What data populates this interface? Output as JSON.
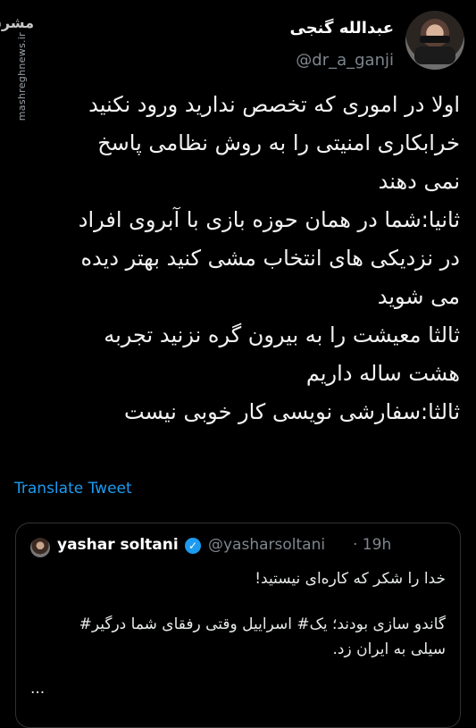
{
  "header": {
    "display_name": "عبدالله گنجی",
    "handle": "@dr_a_ganji"
  },
  "watermark": {
    "logo": "مشرق",
    "url": "mashreghnews.ir"
  },
  "tweet": {
    "lines": [
      "اولا در اموری که تخصص ندارید ورود نکنید",
      "خرابکاری امنیتی را به روش نظامی پاسخ",
      "نمی دهند",
      "ثانیا:شما  در همان حوزه بازی با آبروی افراد",
      "در نزدیکی های انتخاب مشی کنید بهتر دیده",
      "می شوید",
      "ثالثا معیشت را به بیرون گره نزنید تجربه",
      "هشت ساله داریم",
      "ثالثا:سفارشی نویسی کار خوبی نیست"
    ],
    "translate_label": "Translate Tweet"
  },
  "quote": {
    "name": "yashar soltani",
    "handle": "@yasharsoltani",
    "time": "· 19h",
    "lines": [
      "خدا را شکر که کاره‌ای نیستید!",
      "گاندو سازی بودند؛ یک# اسراییل وقتی رفقای شما درگیر#",
      "سیلی به ایران زد."
    ],
    "more": "..."
  }
}
